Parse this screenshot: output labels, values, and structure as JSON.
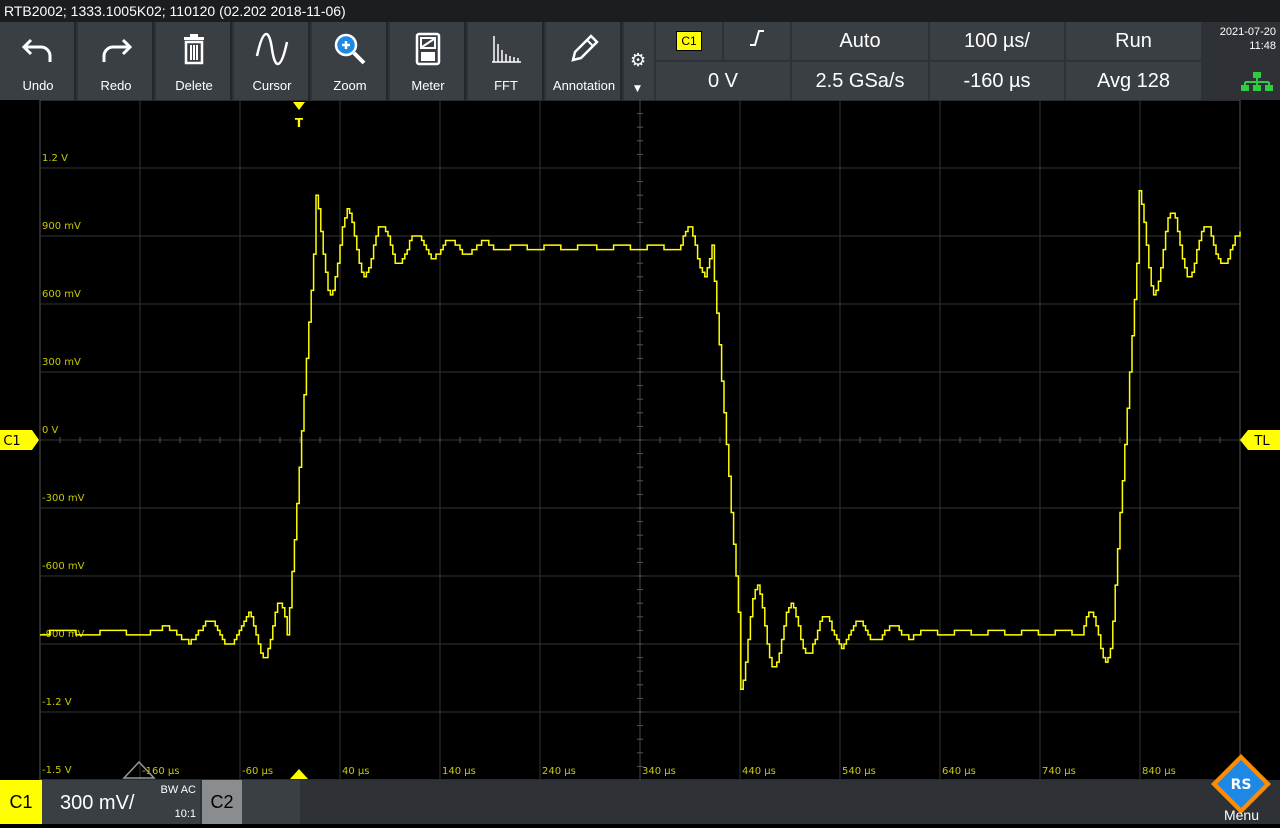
{
  "window": {
    "title": "RTB2002; 1333.1005K02; 110120 (02.202 2018-11-06)"
  },
  "toolbar": {
    "tools": [
      {
        "label": "Undo",
        "icon": "undo-icon"
      },
      {
        "label": "Redo",
        "icon": "redo-icon"
      },
      {
        "label": "Delete",
        "icon": "trash-icon"
      },
      {
        "label": "Cursor",
        "icon": "cursor-wave-icon"
      },
      {
        "label": "Zoom",
        "icon": "zoom-icon"
      },
      {
        "label": "Meter",
        "icon": "meter-icon"
      },
      {
        "label": "FFT",
        "icon": "fft-icon"
      },
      {
        "label": "Annotation",
        "icon": "pencil-icon"
      }
    ],
    "settings_icon": "gear-icon"
  },
  "trigger": {
    "source": "C1",
    "slope_icon": "rising-edge-icon",
    "mode": "Auto",
    "level": "0 V"
  },
  "acquisition": {
    "timebase": "100 µs/",
    "sample_rate": "2.5 GSa/s",
    "position": "-160 µs",
    "state": "Run",
    "average": "Avg 128"
  },
  "clock": {
    "date": "2021-07-20",
    "time": "11:48"
  },
  "status": {
    "network_icon": "network-icon"
  },
  "markers": {
    "trigger_top": "T",
    "channel": "C1",
    "trigger_level": "TL"
  },
  "axes": {
    "y_labels": [
      "1.2 V",
      "900 mV",
      "600 mV",
      "300 mV",
      "0 V",
      "-300 mV",
      "-600 mV",
      "-900 mV",
      "-1.2 V",
      "-1.5 V"
    ],
    "x_labels": [
      "-160 µs",
      "-60 µs",
      "40 µs",
      "140 µs",
      "240 µs",
      "340 µs",
      "440 µs",
      "540 µs",
      "640 µs",
      "740 µs",
      "840 µs"
    ]
  },
  "channel1": {
    "name": "C1",
    "scale": "300 mV/",
    "bw_label": "BW AC",
    "probe": "10:1",
    "color": "#ffff00"
  },
  "channel2": {
    "name": "C2"
  },
  "menu": {
    "label": "Menu",
    "logo_text": "RS"
  },
  "colors": {
    "accent": "#ffff00",
    "background": "#000000",
    "panel": "#3a3f44"
  }
}
